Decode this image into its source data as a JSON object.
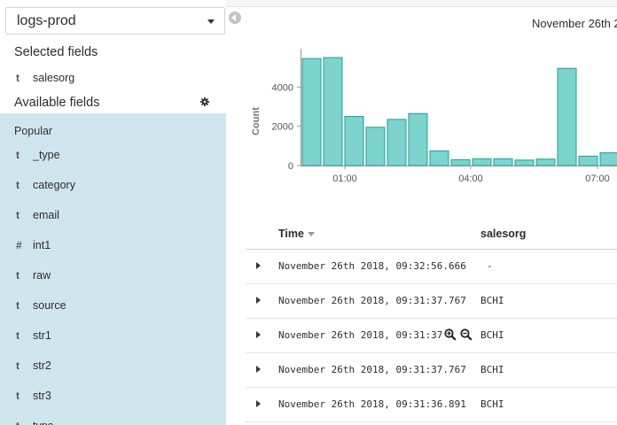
{
  "index": {
    "selected": "logs-prod"
  },
  "sidebar": {
    "selected_title": "Selected fields",
    "selected_fields": [
      {
        "type": "t",
        "name": "salesorg"
      }
    ],
    "available_title": "Available fields",
    "popular_label": "Popular",
    "available_fields": [
      {
        "type": "t",
        "name": "_type"
      },
      {
        "type": "t",
        "name": "category"
      },
      {
        "type": "t",
        "name": "email"
      },
      {
        "type": "#",
        "name": "int1"
      },
      {
        "type": "t",
        "name": "raw"
      },
      {
        "type": "t",
        "name": "source"
      },
      {
        "type": "t",
        "name": "str1"
      },
      {
        "type": "t",
        "name": "str2"
      },
      {
        "type": "t",
        "name": "str3"
      },
      {
        "type": "t",
        "name": "type"
      }
    ]
  },
  "chart_header": "November 26th 2",
  "chart_data": {
    "type": "bar",
    "ylabel": "Count",
    "ylim": [
      0,
      5500
    ],
    "y_ticks": [
      0,
      2000,
      4000
    ],
    "y_tick_labels": [
      "0",
      "2000",
      "4000"
    ],
    "x_tick_labels": [
      "01:00",
      "04:00",
      "07:00"
    ],
    "bar_color": "#7dd3cd",
    "bar_edge_color": "#1ba196",
    "values": [
      5450,
      5500,
      2500,
      1950,
      2350,
      2650,
      750,
      300,
      350,
      350,
      280,
      330,
      4950,
      480,
      650
    ]
  },
  "table": {
    "headers": {
      "time": "Time",
      "salesorg": "salesorg"
    },
    "rows": [
      {
        "time": "November 26th 2018, 09:32:56.666",
        "salesorg": "-"
      },
      {
        "time": "November 26th 2018, 09:31:37.767",
        "salesorg": "BCHI"
      },
      {
        "time": "November 26th 2018, 09:31:37.767",
        "salesorg": "BCHI"
      },
      {
        "time": "November 26th 2018, 09:31:37.767",
        "salesorg": "BCHI"
      },
      {
        "time": "November 26th 2018, 09:31:36.891",
        "salesorg": "BCHI"
      }
    ]
  }
}
